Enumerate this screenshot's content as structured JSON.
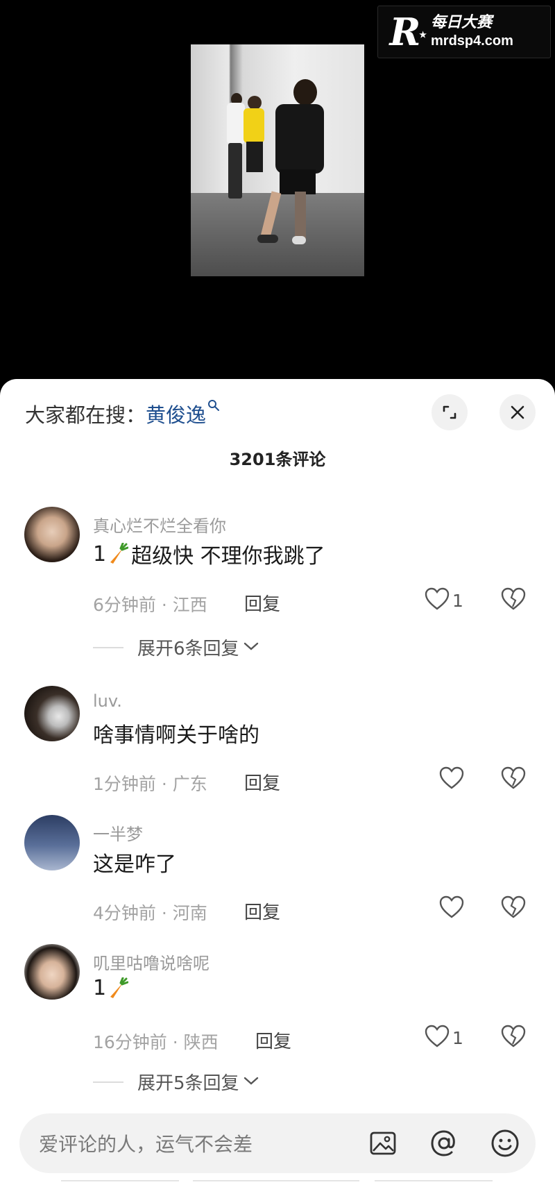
{
  "watermark": {
    "brand_letter": "R",
    "brand_cn": "每日大赛",
    "url": "mrdsp4.com"
  },
  "sheet": {
    "search_prefix": "大家都在搜：",
    "search_term": "黄俊逸",
    "comment_count_title": "3201条评论",
    "close_icon": "close-icon",
    "expand_icon": "expand-icon"
  },
  "comments": [
    {
      "username": "真心烂不烂全看你",
      "prefix": "1",
      "emoji": "carrot-emoji",
      "text": "超级快 不理你我跳了",
      "time": "6分钟前",
      "location": "江西",
      "time_location": "6分钟前 · 江西",
      "reply_label": "回复",
      "likes": "1",
      "expand_replies": "展开6条回复"
    },
    {
      "username": "luv.",
      "text": "啥事情啊关于啥的",
      "time": "1分钟前",
      "location": "广东",
      "time_location": "1分钟前 · 广东",
      "reply_label": "回复"
    },
    {
      "username": "一半梦",
      "text": "这是咋了",
      "time": "4分钟前",
      "location": "河南",
      "time_location": "4分钟前 · 河南",
      "reply_label": "回复"
    },
    {
      "username": "叽里咕噜说啥呢",
      "prefix": "1",
      "emoji": "carrot-emoji",
      "text": "",
      "time": "16分钟前",
      "location": "陕西",
      "time_location": "16分钟前 · 陕西",
      "reply_label": "回复",
      "likes": "1",
      "expand_replies": "展开5条回复"
    }
  ],
  "input_bar": {
    "placeholder": "爱评论的人，运气不会差",
    "icons": [
      "image-icon",
      "at-icon",
      "emoji-icon"
    ]
  },
  "colors": {
    "search_term": "#1f4f8f",
    "meta_gray": "#a3a3a3",
    "sheet_bg": "#ffffff",
    "video_bg": "#000000"
  }
}
